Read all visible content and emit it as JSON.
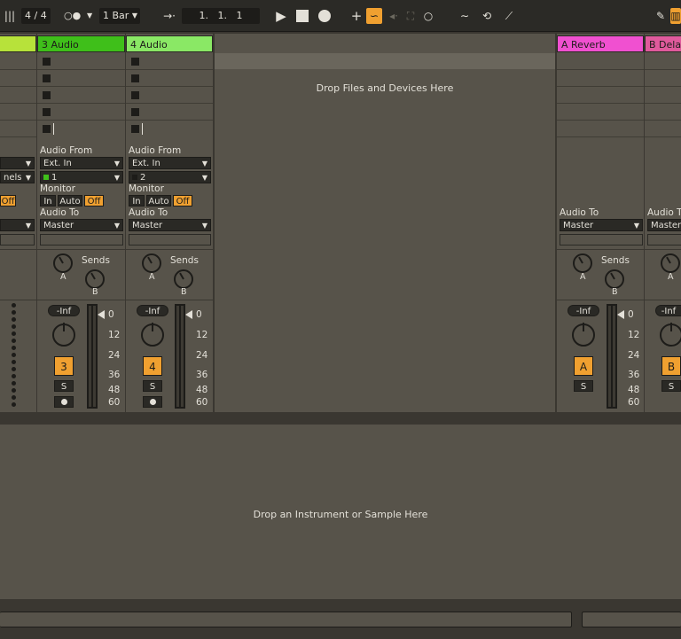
{
  "transport": {
    "time_signature": "4 / 4",
    "quantize": "1 Bar",
    "position": "1.   1.   1"
  },
  "tracks": [
    {
      "name": "3 Audio",
      "color": "#3fbf1a",
      "audio_from": "Ext. In",
      "input_channel": "1",
      "monitor": [
        "In",
        "Auto",
        "Off"
      ],
      "audio_to": "Master",
      "sends_label": "Sends",
      "knob_a": "A",
      "knob_b": "B",
      "volume": "-Inf",
      "number": "3",
      "solo": "S"
    },
    {
      "name": "4 Audio",
      "color": "#8ae865",
      "audio_from": "Ext. In",
      "input_channel": "2",
      "monitor": [
        "In",
        "Auto",
        "Off"
      ],
      "audio_to": "Master",
      "sends_label": "Sends",
      "knob_a": "A",
      "knob_b": "B",
      "volume": "-Inf",
      "number": "4",
      "solo": "S"
    }
  ],
  "partial_track": {
    "channels_label": "nels",
    "monitor_off": "Off"
  },
  "labels": {
    "audio_from": "Audio From",
    "monitor": "Monitor",
    "audio_to": "Audio To"
  },
  "returns": [
    {
      "name": "A Reverb",
      "color": "#f050d0",
      "audio_to": "Master",
      "sends_label": "Sends",
      "knob_a": "A",
      "knob_b": "B",
      "volume": "-Inf",
      "letter": "A",
      "solo": "S"
    },
    {
      "name": "B Delay",
      "color": "#e05a9c",
      "audio_to": "Master",
      "knob_a": "A",
      "volume": "-Inf",
      "letter": "B",
      "solo": "S",
      "audio_to_label": "Audio T"
    }
  ],
  "meter_scale": [
    "0",
    "12",
    "24",
    "36",
    "48",
    "60"
  ],
  "session_drop_text": "Drop Files and Devices Here",
  "device_drop_text": "Drop an Instrument or Sample Here"
}
